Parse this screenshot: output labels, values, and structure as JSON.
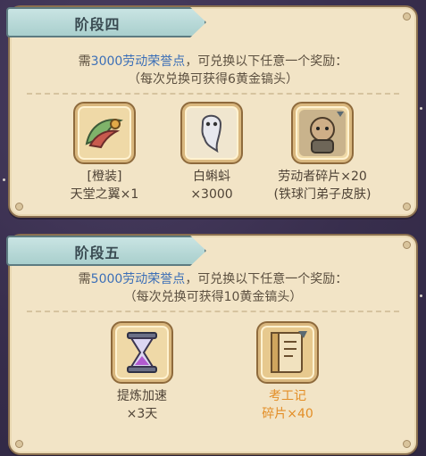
{
  "stages": [
    {
      "title": "阶段四",
      "requirement_prefix": "需",
      "requirement_points": "3000劳动荣誉点",
      "requirement_suffix": "，可兑换以下任意一个奖励：",
      "note": "（每次兑换可获得6黄金镐头）",
      "rewards": [
        {
          "line1": "[橙装]",
          "line2": "天堂之翼×1",
          "icon": "angel-wing-icon"
        },
        {
          "line1": "白蝌蚪",
          "line2": "×3000",
          "icon": "white-tadpole-icon"
        },
        {
          "line1": "劳动者碎片×20",
          "line2": "(铁球门弟子皮肤)",
          "icon": "worker-fragment-icon"
        }
      ]
    },
    {
      "title": "阶段五",
      "requirement_prefix": "需",
      "requirement_points": "5000劳动荣誉点",
      "requirement_suffix": "，可兑换以下任意一个奖励：",
      "note": "（每次兑换可获得10黄金镐头）",
      "rewards": [
        {
          "line1": "提炼加速",
          "line2": "×3天",
          "icon": "hourglass-icon"
        },
        {
          "line1": "考工记",
          "line2": "碎片×40",
          "icon": "kaogongji-book-icon",
          "highlight_color": "#e38e27"
        }
      ]
    }
  ],
  "colors": {
    "panel": "#f2e4c6",
    "banner": "#b6d9d7",
    "points": "#3c6fb7",
    "highlight": "#e38e27",
    "background": "#3b3150"
  }
}
